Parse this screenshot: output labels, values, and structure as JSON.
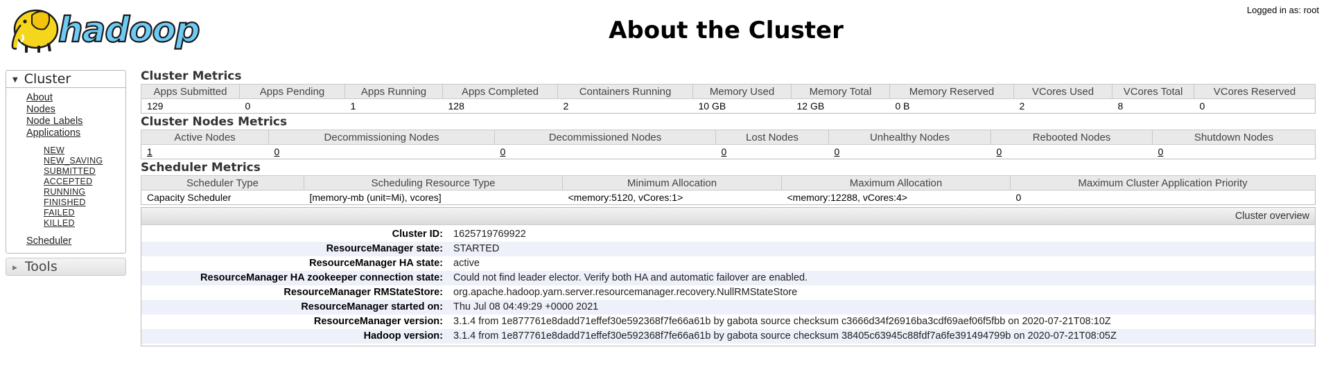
{
  "header": {
    "title": "About the Cluster",
    "logged_in": "Logged in as: root",
    "logo_text": "hadoop"
  },
  "sidebar": {
    "cluster": {
      "label": "Cluster",
      "links": [
        "About",
        "Nodes",
        "Node Labels",
        "Applications"
      ],
      "app_states": [
        "NEW",
        "NEW_SAVING",
        "SUBMITTED",
        "ACCEPTED",
        "RUNNING",
        "FINISHED",
        "FAILED",
        "KILLED"
      ],
      "scheduler": "Scheduler"
    },
    "tools": {
      "label": "Tools"
    }
  },
  "cluster_metrics": {
    "title": "Cluster Metrics",
    "headers": [
      "Apps Submitted",
      "Apps Pending",
      "Apps Running",
      "Apps Completed",
      "Containers Running",
      "Memory Used",
      "Memory Total",
      "Memory Reserved",
      "VCores Used",
      "VCores Total",
      "VCores Reserved"
    ],
    "values": [
      "129",
      "0",
      "1",
      "128",
      "2",
      "10 GB",
      "12 GB",
      "0 B",
      "2",
      "8",
      "0"
    ]
  },
  "node_metrics": {
    "title": "Cluster Nodes Metrics",
    "headers": [
      "Active Nodes",
      "Decommissioning Nodes",
      "Decommissioned Nodes",
      "Lost Nodes",
      "Unhealthy Nodes",
      "Rebooted Nodes",
      "Shutdown Nodes"
    ],
    "values": [
      "1",
      "0",
      "0",
      "0",
      "0",
      "0",
      "0"
    ]
  },
  "scheduler_metrics": {
    "title": "Scheduler Metrics",
    "headers": [
      "Scheduler Type",
      "Scheduling Resource Type",
      "Minimum Allocation",
      "Maximum Allocation",
      "Maximum Cluster Application Priority"
    ],
    "values": [
      "Capacity Scheduler",
      "[memory-mb (unit=Mi), vcores]",
      "<memory:5120, vCores:1>",
      "<memory:12288, vCores:4>",
      "0"
    ]
  },
  "overview": {
    "title": "Cluster overview",
    "rows": [
      {
        "key": "Cluster ID:",
        "value": "1625719769922"
      },
      {
        "key": "ResourceManager state:",
        "value": "STARTED"
      },
      {
        "key": "ResourceManager HA state:",
        "value": "active"
      },
      {
        "key": "ResourceManager HA zookeeper connection state:",
        "value": "Could not find leader elector. Verify both HA and automatic failover are enabled."
      },
      {
        "key": "ResourceManager RMStateStore:",
        "value": "org.apache.hadoop.yarn.server.resourcemanager.recovery.NullRMStateStore"
      },
      {
        "key": "ResourceManager started on:",
        "value": "Thu Jul 08 04:49:29 +0000 2021"
      },
      {
        "key": "ResourceManager version:",
        "value": "3.1.4 from 1e877761e8dadd71effef30e592368f7fe66a61b by gabota source checksum c3666d34f26916ba3cdf69aef06f5fbb on 2020-07-21T08:10Z"
      },
      {
        "key": "Hadoop version:",
        "value": "3.1.4 from 1e877761e8dadd71effef30e592368f7fe66a61b by gabota source checksum 38405c63945c88fdf7a6fe391494799b on 2020-07-21T08:05Z"
      }
    ]
  },
  "colors": {
    "logo_yellow": "#f5d61c",
    "logo_blue": "#6ecbf5",
    "table_header_bg": "#e9e9e9",
    "stripe_bg": "#eef0fa"
  }
}
